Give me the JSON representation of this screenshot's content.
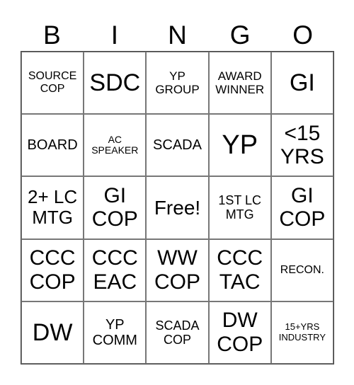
{
  "header": [
    "B",
    "I",
    "N",
    "G",
    "O"
  ],
  "cells": [
    "SOURCE\nCOP",
    "SDC",
    "YP\nGROUP",
    "AWARD\nWINNER",
    "GI",
    "BOARD",
    "AC\nSPEAKER",
    "SCADA",
    "YP",
    "<15\nYRS",
    "2+ LC\nMTG",
    "GI\nCOP",
    "Free!",
    "1ST LC\nMTG",
    "GI\nCOP",
    "CCC\nCOP",
    "CCC\nEAC",
    "WW\nCOP",
    "CCC\nTAC",
    "RECON.",
    "DW",
    "YP\nCOMM",
    "SCADA\nCOP",
    "DW\nCOP",
    "15+YRS\nINDUSTRY"
  ]
}
